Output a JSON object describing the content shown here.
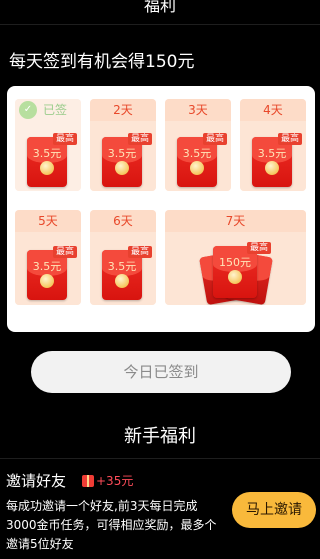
{
  "header": {
    "title": "福利"
  },
  "checkin": {
    "headline": "每天签到有机会得150元",
    "max_badge": "最高",
    "stamp": "已签",
    "days": [
      {
        "label": "已签",
        "amount": "3.5元",
        "done": true
      },
      {
        "label": "2天",
        "amount": "3.5元"
      },
      {
        "label": "3天",
        "amount": "3.5元"
      },
      {
        "label": "4天",
        "amount": "3.5元"
      },
      {
        "label": "5天",
        "amount": "3.5元"
      },
      {
        "label": "6天",
        "amount": "3.5元"
      },
      {
        "label": "7天",
        "amount": "150元"
      }
    ],
    "signed_button": "今日已签到"
  },
  "newbie": {
    "title": "新手福利",
    "invite_title": "邀请好友",
    "reward": "+35元",
    "description": "每成功邀请一个好友,前3天每日完成3000金币任务，可得相应奖励，最多个邀请5位好友",
    "invite_button": "马上邀请"
  },
  "colors": {
    "accent": "#f9b93b",
    "envelope": "#e8251d",
    "card_bg": "#fde5d5"
  }
}
